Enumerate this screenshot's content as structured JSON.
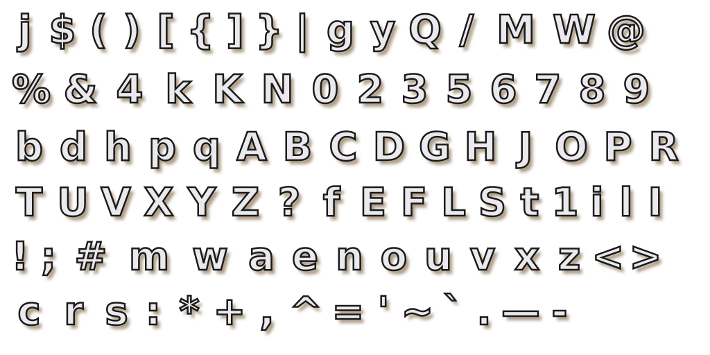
{
  "rows": [
    [
      "j",
      "$",
      "(",
      ")",
      "[",
      "{",
      "]",
      "}",
      "|",
      "g",
      "y",
      "Q",
      "/",
      "M",
      "W",
      "@"
    ],
    [
      "%",
      "&",
      "4",
      "k",
      "K",
      "N",
      "0",
      "2",
      "3",
      "5",
      "6",
      "7",
      "8",
      "9"
    ],
    [
      "b",
      "d",
      "h",
      "p",
      "q",
      "A",
      "B",
      "C",
      "D",
      "G",
      "H",
      "J",
      "O",
      "P",
      "R"
    ],
    [
      "T",
      "U",
      "V",
      "X",
      "Y",
      "Z",
      "?",
      "f",
      "E",
      "F",
      "L",
      "S",
      "t",
      "1",
      "i",
      "l",
      "I"
    ],
    [
      "!",
      ";",
      "#",
      "m",
      "w",
      "a",
      "e",
      "n",
      "o",
      "u",
      "v",
      "x",
      "z",
      "<",
      ">"
    ],
    [
      "c",
      "r",
      "s",
      ":",
      "*",
      "+",
      ",",
      "^",
      "=",
      "'",
      "~",
      "`",
      ".",
      "—",
      "-"
    ]
  ],
  "colors": {
    "glyph_fill": "#e9e9ee",
    "glyph_outline": "#1a1a1a",
    "glyph_shadow": "#6e5028",
    "background": "#ffffff"
  }
}
